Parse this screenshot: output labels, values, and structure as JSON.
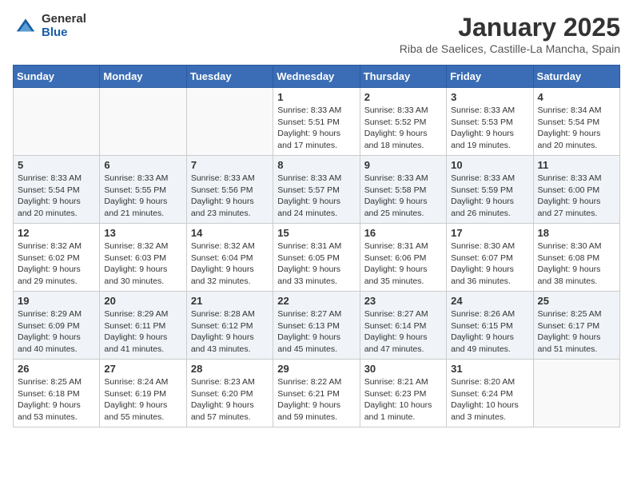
{
  "header": {
    "logo_general": "General",
    "logo_blue": "Blue",
    "month_title": "January 2025",
    "location": "Riba de Saelices, Castille-La Mancha, Spain"
  },
  "days_of_week": [
    "Sunday",
    "Monday",
    "Tuesday",
    "Wednesday",
    "Thursday",
    "Friday",
    "Saturday"
  ],
  "weeks": [
    [
      {
        "day": "",
        "info": ""
      },
      {
        "day": "",
        "info": ""
      },
      {
        "day": "",
        "info": ""
      },
      {
        "day": "1",
        "info": "Sunrise: 8:33 AM\nSunset: 5:51 PM\nDaylight: 9 hours\nand 17 minutes."
      },
      {
        "day": "2",
        "info": "Sunrise: 8:33 AM\nSunset: 5:52 PM\nDaylight: 9 hours\nand 18 minutes."
      },
      {
        "day": "3",
        "info": "Sunrise: 8:33 AM\nSunset: 5:53 PM\nDaylight: 9 hours\nand 19 minutes."
      },
      {
        "day": "4",
        "info": "Sunrise: 8:34 AM\nSunset: 5:54 PM\nDaylight: 9 hours\nand 20 minutes."
      }
    ],
    [
      {
        "day": "5",
        "info": "Sunrise: 8:33 AM\nSunset: 5:54 PM\nDaylight: 9 hours\nand 20 minutes."
      },
      {
        "day": "6",
        "info": "Sunrise: 8:33 AM\nSunset: 5:55 PM\nDaylight: 9 hours\nand 21 minutes."
      },
      {
        "day": "7",
        "info": "Sunrise: 8:33 AM\nSunset: 5:56 PM\nDaylight: 9 hours\nand 23 minutes."
      },
      {
        "day": "8",
        "info": "Sunrise: 8:33 AM\nSunset: 5:57 PM\nDaylight: 9 hours\nand 24 minutes."
      },
      {
        "day": "9",
        "info": "Sunrise: 8:33 AM\nSunset: 5:58 PM\nDaylight: 9 hours\nand 25 minutes."
      },
      {
        "day": "10",
        "info": "Sunrise: 8:33 AM\nSunset: 5:59 PM\nDaylight: 9 hours\nand 26 minutes."
      },
      {
        "day": "11",
        "info": "Sunrise: 8:33 AM\nSunset: 6:00 PM\nDaylight: 9 hours\nand 27 minutes."
      }
    ],
    [
      {
        "day": "12",
        "info": "Sunrise: 8:32 AM\nSunset: 6:02 PM\nDaylight: 9 hours\nand 29 minutes."
      },
      {
        "day": "13",
        "info": "Sunrise: 8:32 AM\nSunset: 6:03 PM\nDaylight: 9 hours\nand 30 minutes."
      },
      {
        "day": "14",
        "info": "Sunrise: 8:32 AM\nSunset: 6:04 PM\nDaylight: 9 hours\nand 32 minutes."
      },
      {
        "day": "15",
        "info": "Sunrise: 8:31 AM\nSunset: 6:05 PM\nDaylight: 9 hours\nand 33 minutes."
      },
      {
        "day": "16",
        "info": "Sunrise: 8:31 AM\nSunset: 6:06 PM\nDaylight: 9 hours\nand 35 minutes."
      },
      {
        "day": "17",
        "info": "Sunrise: 8:30 AM\nSunset: 6:07 PM\nDaylight: 9 hours\nand 36 minutes."
      },
      {
        "day": "18",
        "info": "Sunrise: 8:30 AM\nSunset: 6:08 PM\nDaylight: 9 hours\nand 38 minutes."
      }
    ],
    [
      {
        "day": "19",
        "info": "Sunrise: 8:29 AM\nSunset: 6:09 PM\nDaylight: 9 hours\nand 40 minutes."
      },
      {
        "day": "20",
        "info": "Sunrise: 8:29 AM\nSunset: 6:11 PM\nDaylight: 9 hours\nand 41 minutes."
      },
      {
        "day": "21",
        "info": "Sunrise: 8:28 AM\nSunset: 6:12 PM\nDaylight: 9 hours\nand 43 minutes."
      },
      {
        "day": "22",
        "info": "Sunrise: 8:27 AM\nSunset: 6:13 PM\nDaylight: 9 hours\nand 45 minutes."
      },
      {
        "day": "23",
        "info": "Sunrise: 8:27 AM\nSunset: 6:14 PM\nDaylight: 9 hours\nand 47 minutes."
      },
      {
        "day": "24",
        "info": "Sunrise: 8:26 AM\nSunset: 6:15 PM\nDaylight: 9 hours\nand 49 minutes."
      },
      {
        "day": "25",
        "info": "Sunrise: 8:25 AM\nSunset: 6:17 PM\nDaylight: 9 hours\nand 51 minutes."
      }
    ],
    [
      {
        "day": "26",
        "info": "Sunrise: 8:25 AM\nSunset: 6:18 PM\nDaylight: 9 hours\nand 53 minutes."
      },
      {
        "day": "27",
        "info": "Sunrise: 8:24 AM\nSunset: 6:19 PM\nDaylight: 9 hours\nand 55 minutes."
      },
      {
        "day": "28",
        "info": "Sunrise: 8:23 AM\nSunset: 6:20 PM\nDaylight: 9 hours\nand 57 minutes."
      },
      {
        "day": "29",
        "info": "Sunrise: 8:22 AM\nSunset: 6:21 PM\nDaylight: 9 hours\nand 59 minutes."
      },
      {
        "day": "30",
        "info": "Sunrise: 8:21 AM\nSunset: 6:23 PM\nDaylight: 10 hours\nand 1 minute."
      },
      {
        "day": "31",
        "info": "Sunrise: 8:20 AM\nSunset: 6:24 PM\nDaylight: 10 hours\nand 3 minutes."
      },
      {
        "day": "",
        "info": ""
      }
    ]
  ]
}
